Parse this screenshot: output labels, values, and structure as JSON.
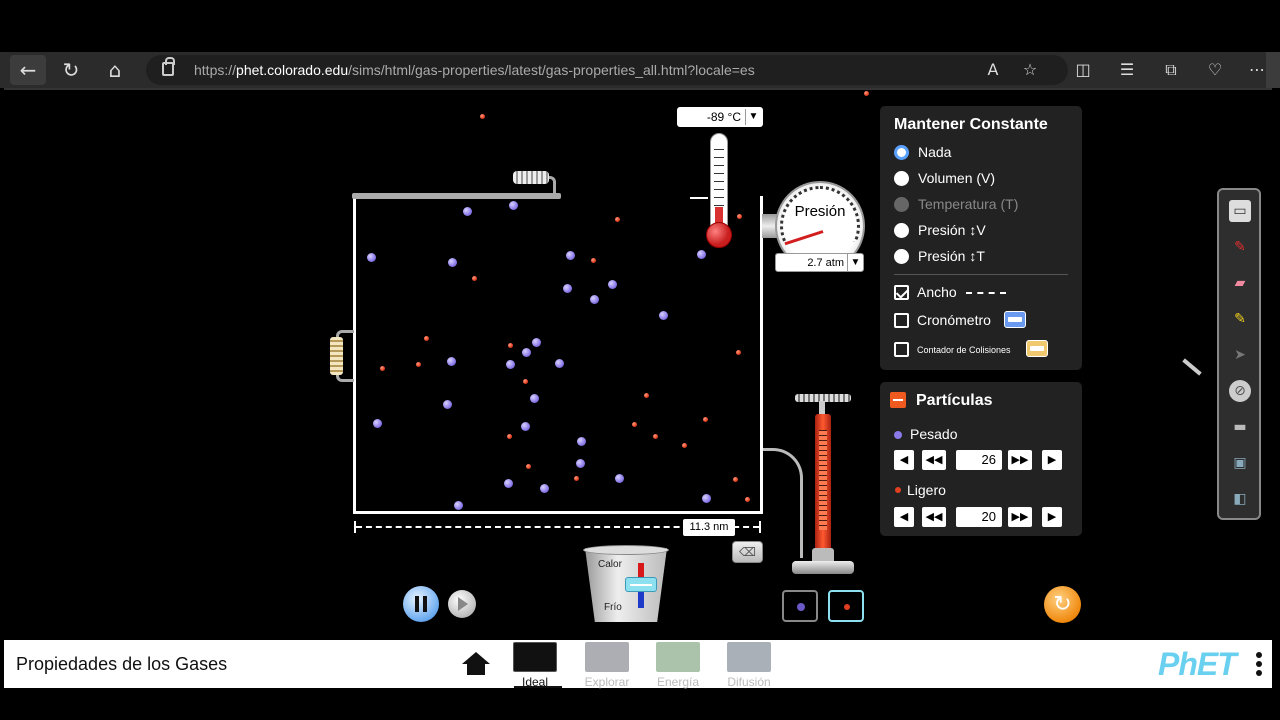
{
  "browser": {
    "url_prefix": "https://",
    "url_host": "phet.colorado.edu",
    "url_path": "/sims/html/gas-properties/latest/gas-properties_all.html?locale=es"
  },
  "sim": {
    "title": "Propiedades de los Gases",
    "temperature": {
      "value": "-89 °C"
    },
    "pressure_gauge": {
      "label": "Presión",
      "value": "2.7 atm"
    },
    "width_ruler": {
      "value": "11.3 nm"
    },
    "heater": {
      "hot_label": "Calor",
      "cold_label": "Frío"
    },
    "hold_constant": {
      "title": "Mantener Constante",
      "options": [
        {
          "label": "Nada",
          "selected": true,
          "disabled": false
        },
        {
          "label": "Volumen (V)",
          "selected": false,
          "disabled": false
        },
        {
          "label": "Temperatura (T)",
          "selected": false,
          "disabled": true
        },
        {
          "label": "Presión ↕V",
          "selected": false,
          "disabled": false
        },
        {
          "label": "Presión ↕T",
          "selected": false,
          "disabled": false
        }
      ],
      "checkboxes": [
        {
          "label": "Ancho",
          "checked": true
        },
        {
          "label": "Cronómetro",
          "checked": false
        },
        {
          "label": "Contador de Colisiones",
          "checked": false
        }
      ]
    },
    "particles": {
      "title": "Partículas",
      "heavy": {
        "label": "Pesado",
        "count": "26",
        "color": "#8a7ae8"
      },
      "light": {
        "label": "Ligero",
        "count": "20",
        "color": "#e04020"
      }
    }
  },
  "navbar": {
    "screens": [
      {
        "label": "Ideal",
        "active": true
      },
      {
        "label": "Explorar",
        "active": false
      },
      {
        "label": "Energía",
        "active": false
      },
      {
        "label": "Difusión",
        "active": false
      }
    ],
    "logo": "PhET"
  }
}
